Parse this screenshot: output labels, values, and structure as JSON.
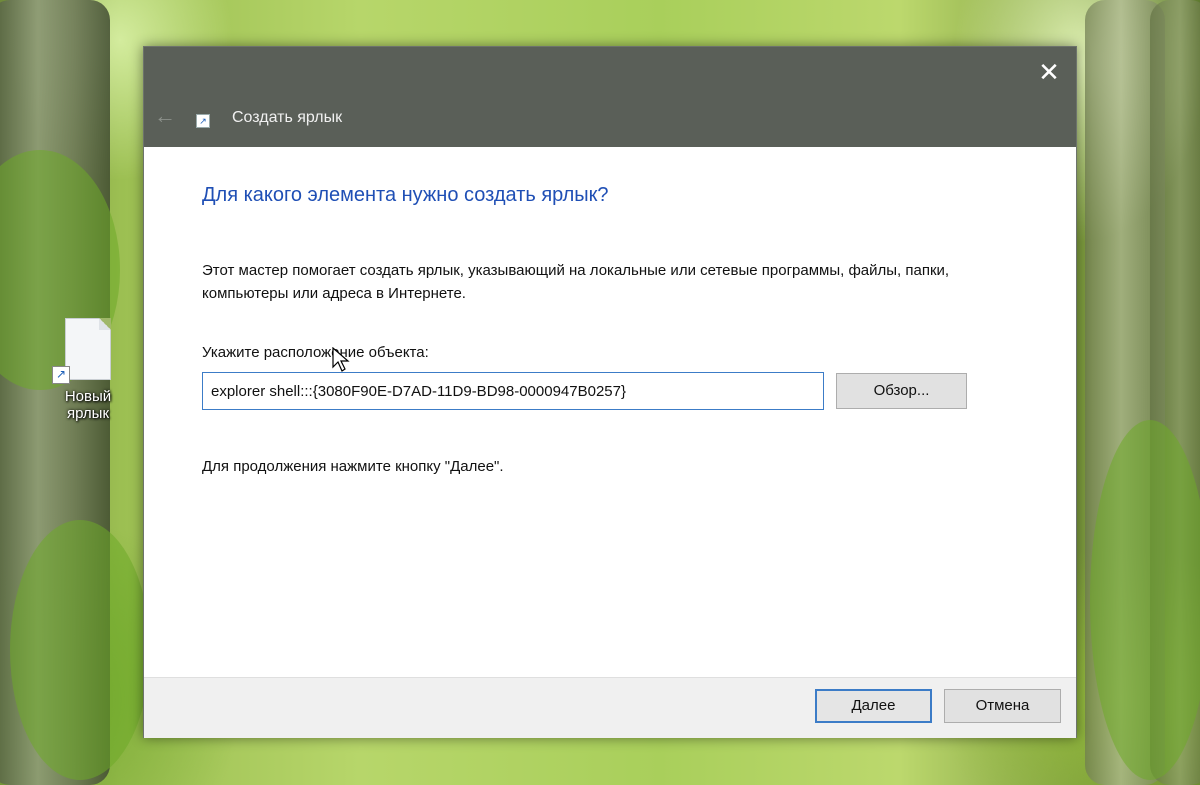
{
  "desktop": {
    "icon_label_line1": "Новый",
    "icon_label_line2": "ярлык"
  },
  "dialog": {
    "title": "Создать ярлык",
    "heading": "Для какого элемента нужно создать ярлык?",
    "description": "Этот мастер помогает создать ярлык, указывающий на локальные или сетевые программы, файлы, папки, компьютеры или адреса в Интернете.",
    "location_label": "Укажите расположение объекта:",
    "location_value": "explorer shell:::{3080F90E-D7AD-11D9-BD98-0000947B0257}",
    "browse_label": "Обзор...",
    "continue_hint": "Для продолжения нажмите кнопку \"Далее\".",
    "next_label": "Далее",
    "cancel_label": "Отмена",
    "close_glyph": "✕",
    "back_glyph": "←"
  },
  "colors": {
    "titlebar": "#5a5f58",
    "heading": "#1f4fb5",
    "accent_border": "#3c7cc7",
    "footer": "#f0f0f0"
  }
}
